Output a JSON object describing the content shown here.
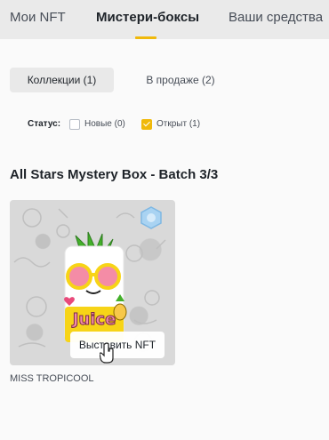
{
  "tabs": [
    {
      "label": "Мои NFT",
      "active": false
    },
    {
      "label": "Мистери-боксы",
      "active": true
    },
    {
      "label": "Ваши средства",
      "active": false
    }
  ],
  "accent_color": "#f0b90b",
  "filters": {
    "collections_label": "Коллекции (1)",
    "on_sale_label": "В продаже (2)"
  },
  "status": {
    "label": "Статус:",
    "options": [
      {
        "label": "Новые (0)",
        "checked": false
      },
      {
        "label": "Открыт (1)",
        "checked": true
      }
    ]
  },
  "collection": {
    "title": "All Stars Mystery Box - Batch 3/3",
    "items": [
      {
        "name": "MISS TROPICOOL",
        "image_text": "Juice",
        "action_label": "Выставить NFT",
        "badge_icon": "hexagon-badge-icon"
      }
    ]
  }
}
